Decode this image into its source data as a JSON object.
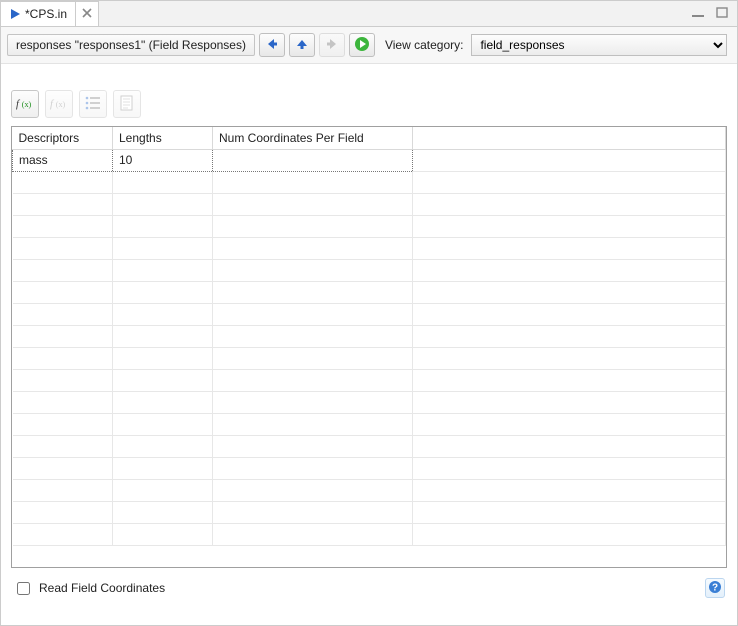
{
  "tab": {
    "title": "*CPS.in"
  },
  "toolbar": {
    "breadcrumb": "responses \"responses1\" (Field Responses)",
    "view_category_label": "View category:",
    "view_category_value": "field_responses"
  },
  "table": {
    "headers": {
      "c1": "Descriptors",
      "c2": "Lengths",
      "c3": "Num Coordinates Per Field"
    },
    "row1": {
      "descriptors": "mass",
      "lengths": "10",
      "num_coords": ""
    }
  },
  "footer": {
    "checkbox_label": "Read Field Coordinates"
  }
}
